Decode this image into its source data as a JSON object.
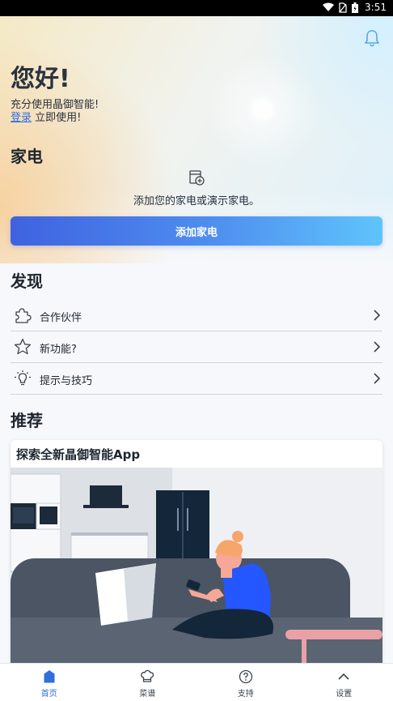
{
  "status_bar": {
    "time": "3:51"
  },
  "header": {
    "greeting": "您好!",
    "subtitle": "充分使用晶御智能!",
    "login_link": "登录",
    "login_suffix": " 立即使用!"
  },
  "appliances": {
    "title": "家电",
    "empty_text": "添加您的家电或演示家电。",
    "add_button": "添加家电"
  },
  "discover": {
    "title": "发现",
    "items": [
      {
        "label": "合作伙伴",
        "icon": "puzzle-icon"
      },
      {
        "label": "新功能?",
        "icon": "star-icon"
      },
      {
        "label": "提示与技巧",
        "icon": "lightbulb-icon"
      }
    ]
  },
  "recommend": {
    "title": "推荐",
    "card_title": "探索全新晶御智能App"
  },
  "bottom_nav": {
    "items": [
      {
        "label": "首页",
        "icon": "home-icon",
        "active": true
      },
      {
        "label": "菜谱",
        "icon": "chef-hat-icon",
        "active": false
      },
      {
        "label": "支持",
        "icon": "help-icon",
        "active": false
      },
      {
        "label": "设置",
        "icon": "chevron-up-icon",
        "active": false
      }
    ]
  },
  "colors": {
    "accent": "#2f6fe0",
    "button_start": "#3f62e0",
    "button_end": "#5fc4fb"
  }
}
